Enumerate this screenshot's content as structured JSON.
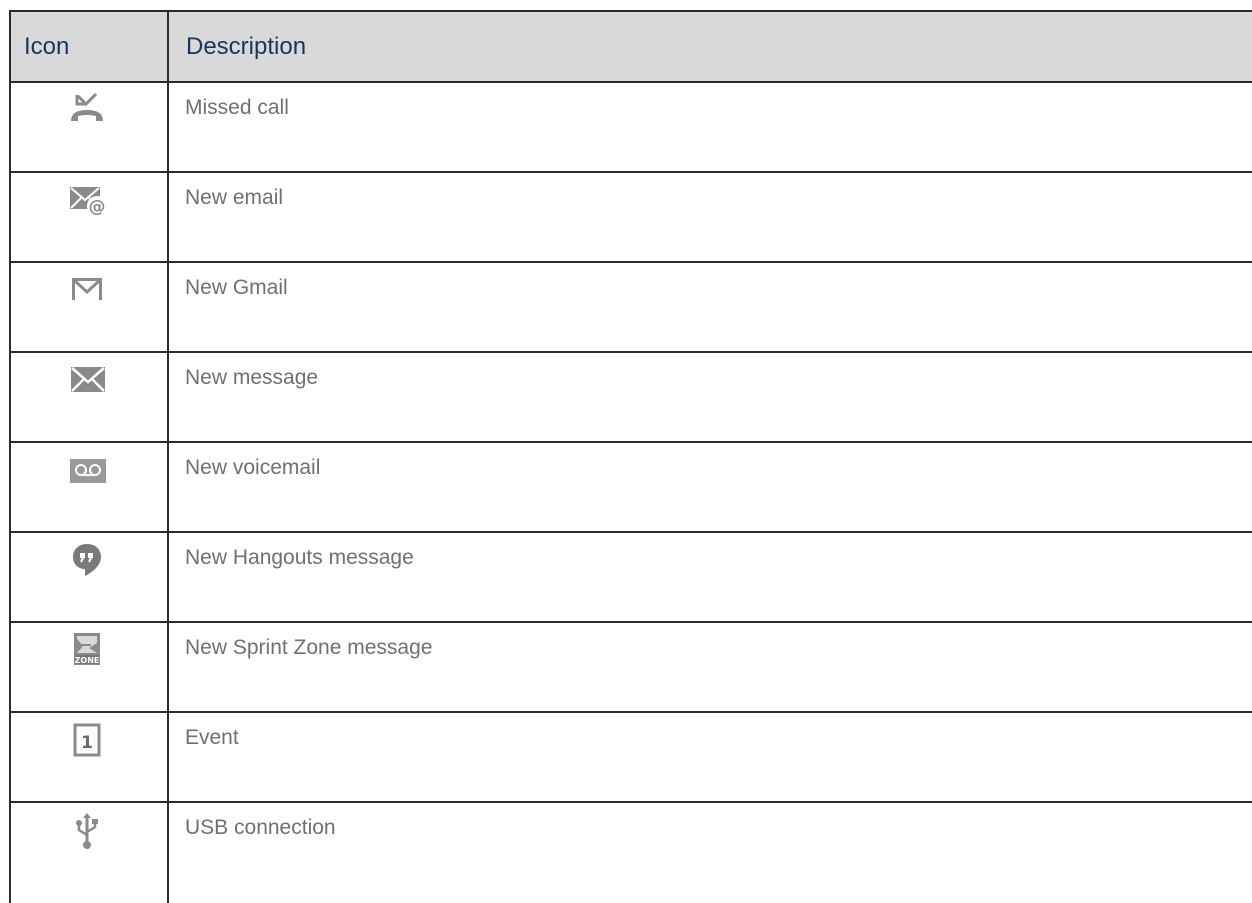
{
  "table": {
    "header": {
      "icon": "Icon",
      "description": "Description"
    },
    "rows": [
      {
        "icon": "missed-call-icon",
        "description": "Missed call"
      },
      {
        "icon": "new-email-icon",
        "description": "New email"
      },
      {
        "icon": "gmail-icon",
        "description": "New Gmail"
      },
      {
        "icon": "message-envelope-icon",
        "description": "New message"
      },
      {
        "icon": "voicemail-icon",
        "description": "New voicemail"
      },
      {
        "icon": "hangouts-icon",
        "description": "New Hangouts message"
      },
      {
        "icon": "sprint-zone-icon",
        "description": "New Sprint Zone message"
      },
      {
        "icon": "calendar-event-icon",
        "description": "Event"
      },
      {
        "icon": "usb-icon",
        "description": "USB connection"
      }
    ]
  },
  "colors": {
    "header_bg": "#d9d9d9",
    "header_text": "#17365d",
    "body_text": "#707070",
    "icon_gray": "#8a8a8a",
    "border": "#2b2b2b"
  }
}
